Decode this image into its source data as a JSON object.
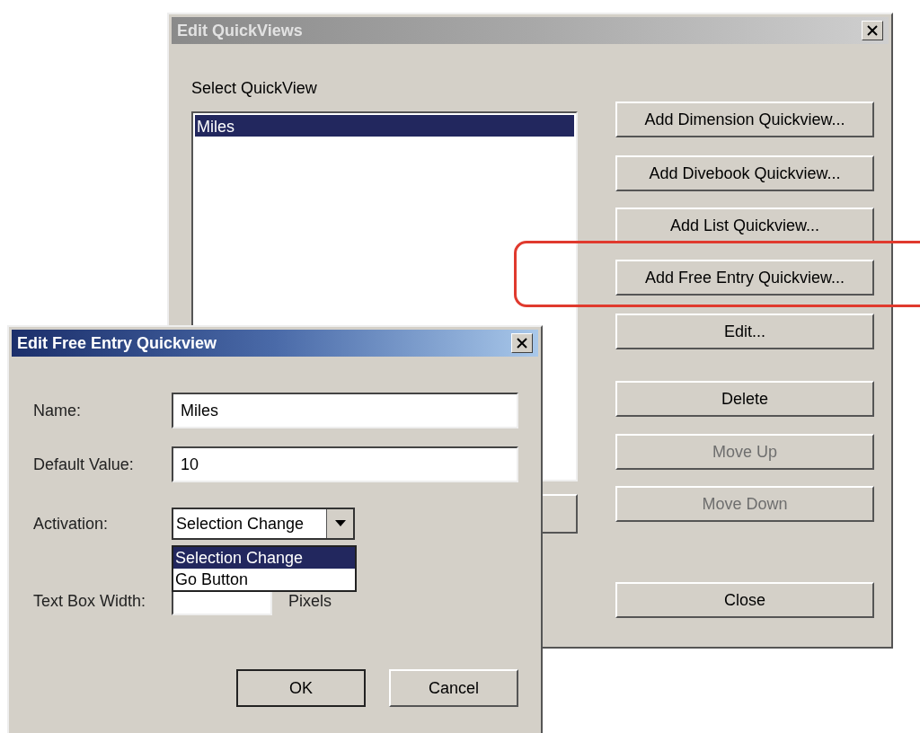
{
  "main_window": {
    "title": "Edit QuickViews",
    "active": false,
    "list_label": "Select QuickView",
    "list_items": [
      {
        "label": "Miles",
        "selected": true
      }
    ],
    "buttons": [
      {
        "label": "Add Dimension Quickview...",
        "disabled": false,
        "highlighted": false
      },
      {
        "label": "Add Divebook Quickview...",
        "disabled": false,
        "highlighted": false
      },
      {
        "label": "Add List Quickview...",
        "disabled": false,
        "highlighted": false
      },
      {
        "label": "Add Free Entry Quickview...",
        "disabled": false,
        "highlighted": true
      },
      {
        "label": "Edit...",
        "disabled": false,
        "highlighted": false
      },
      {
        "label": "Delete",
        "disabled": false,
        "highlighted": false
      },
      {
        "label": "Move Up",
        "disabled": true,
        "highlighted": false
      },
      {
        "label": "Move Down",
        "disabled": true,
        "highlighted": false
      },
      {
        "label": "Close",
        "disabled": false,
        "highlighted": false
      }
    ]
  },
  "dialog": {
    "title": "Edit Free Entry Quickview",
    "active": true,
    "fields": [
      {
        "kind": "text",
        "label": "Name:",
        "value": "Miles"
      },
      {
        "kind": "text",
        "label": "Default Value:",
        "value": "10"
      },
      {
        "kind": "select",
        "label": "Activation:",
        "value": "Selection Change",
        "expanded": true,
        "options": [
          {
            "label": "Selection Change",
            "selected": true
          },
          {
            "label": "Go Button",
            "selected": false
          }
        ]
      },
      {
        "kind": "number",
        "label": "Text Box Width:",
        "unit": "Pixels"
      }
    ],
    "buttons": [
      {
        "label": "OK",
        "default": true
      },
      {
        "label": "Cancel",
        "default": false
      }
    ]
  }
}
